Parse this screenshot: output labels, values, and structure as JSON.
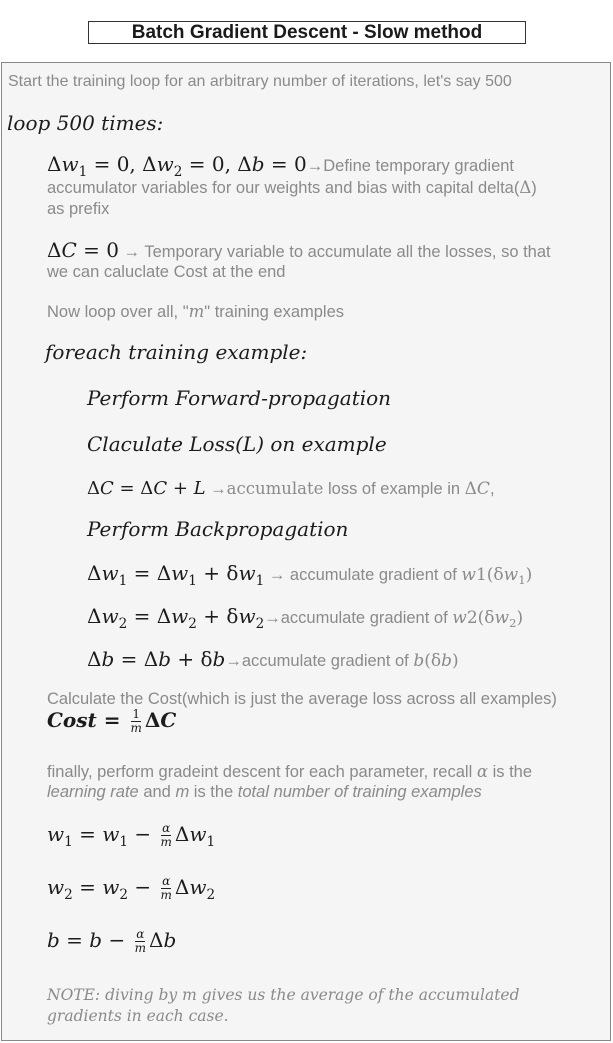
{
  "title": "Batch Gradient Descent - Slow method",
  "intro": "Start the training loop for an arbitrary number of iterations, let's say 500",
  "loop_header": "loop 500 times:",
  "init_grads": {
    "expr_parts": [
      "Δ",
      "w",
      "1",
      " = 0, ",
      "Δ",
      "w",
      "2",
      " = 0, ",
      "Δ",
      "b",
      " = 0"
    ],
    "desc_line1": "→Define temporary gradient",
    "desc_line2": "accumulator variables for our weights and bias with capital delta(",
    "delta_symbol": "Δ",
    "desc_line2_end": ")",
    "desc_line3": "as prefix"
  },
  "init_cost": {
    "expr": "ΔC = 0",
    "desc_line1": " → Temporary variable to accumulate all the losses, so that",
    "desc_line2": "we can caluclate Cost at the end"
  },
  "loop_examples_text": {
    "before": "Now loop over all, \"",
    "m": "m",
    "after": "\" training examples"
  },
  "foreach_header": "foreach training example:",
  "step_forward": "Perform Forward-propagation",
  "step_loss": "Claculate Loss(L) on example",
  "accumulate_loss": {
    "expr": "ΔC = ΔC + L",
    "arrow": " →",
    "word": "accumulate",
    "rest": " loss of example in ",
    "sym": "ΔC",
    "end": ","
  },
  "step_backprop": "Perform Backpropagation",
  "accum_w1": {
    "expr": "Δw₁ = Δw₁ + δw₁",
    "desc": " → accumulate gradient of ",
    "sym": "w1(δw₁)"
  },
  "accum_w2": {
    "expr": "Δw₂ = Δw₂ + δw₂",
    "desc": "→accumulate gradient of ",
    "sym": "w2(δw₂)"
  },
  "accum_b": {
    "expr": "Δb = Δb + δb",
    "desc": "→accumulate gradient of ",
    "sym": "b(δb)"
  },
  "calc_cost_text": "Calculate the Cost(which is just the average loss across all examples)",
  "cost_formula": {
    "lhs": "Cost",
    "eq": " = ",
    "num": "1",
    "den": "m",
    "rhs": "ΔC"
  },
  "finally_text": {
    "line1_a": "finally, perform gradeint descent for each parameter, recall ",
    "alpha": "α",
    "line1_b": " is the",
    "line2_a": "learning rate",
    "line2_b": " and ",
    "line2_m": "m",
    "line2_c": " is the ",
    "line2_d": "total number of training examples"
  },
  "update_w1": {
    "lhs": "w₁ = w₁ − ",
    "num": "α",
    "den": "m",
    "rhs": "Δw₁"
  },
  "update_w2": {
    "lhs": "w₂ = w₂ − ",
    "num": "α",
    "den": "m",
    "rhs": "Δw₂"
  },
  "update_b": {
    "lhs": "b = b − ",
    "num": "α",
    "den": "m",
    "rhs": "Δb"
  },
  "note_line1": "NOTE: diving by m gives us the average of the accumulated",
  "note_line2": "gradients in each case."
}
